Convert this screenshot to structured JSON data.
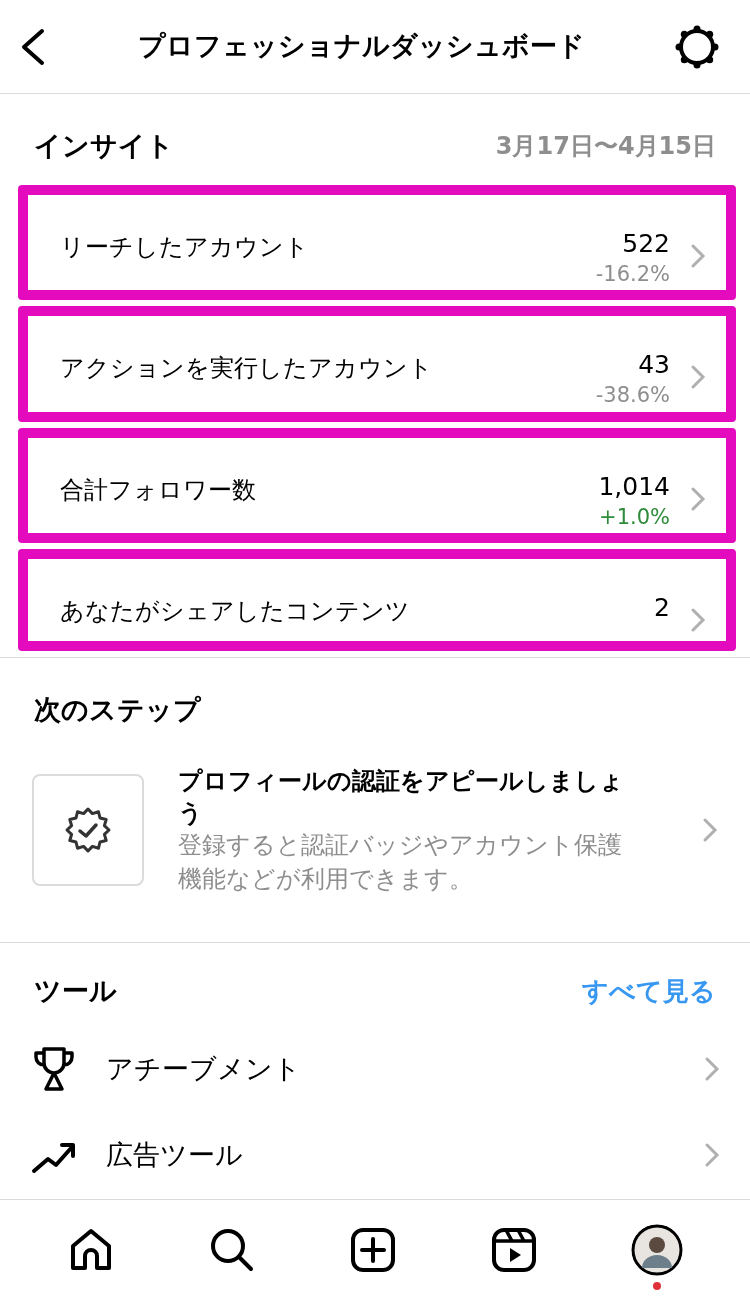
{
  "header": {
    "title": "プロフェッショナルダッシュボード"
  },
  "insights": {
    "title": "インサイト",
    "date_range": "3月17日〜4月15日",
    "rows": [
      {
        "label": "リーチしたアカウント",
        "value": "522",
        "change": "-16.2%",
        "color": "#8e8e8e",
        "highlighted": true
      },
      {
        "label": "アクションを実行したアカウント",
        "value": "43",
        "change": "-38.6%",
        "color": "#8e8e8e",
        "highlighted": true
      },
      {
        "label": "合計フォロワー数",
        "value": "1,014",
        "change": "+1.0%",
        "color": "#2e8b3a",
        "highlighted": true
      },
      {
        "label": "あなたがシェアしたコンテンツ",
        "value": "2",
        "highlighted": true
      }
    ]
  },
  "next_steps": {
    "title": "次のステップ",
    "card": {
      "title": "プロフィールの認証をアピールしましょう",
      "description": "登録すると認証バッジやアカウント保護機能などが利用できます。"
    }
  },
  "tools": {
    "title": "ツール",
    "see_all": "すべて見る",
    "items": [
      {
        "kind": "trophy",
        "label": "アチーブメント"
      },
      {
        "kind": "ads",
        "label": "広告ツール"
      }
    ]
  },
  "bottom_nav": {
    "items": [
      {
        "kind": "home",
        "selected": false
      },
      {
        "kind": "search",
        "selected": false
      },
      {
        "kind": "create",
        "selected": false
      },
      {
        "kind": "reels",
        "selected": false
      },
      {
        "kind": "profile",
        "selected": true,
        "notification": true
      }
    ]
  }
}
